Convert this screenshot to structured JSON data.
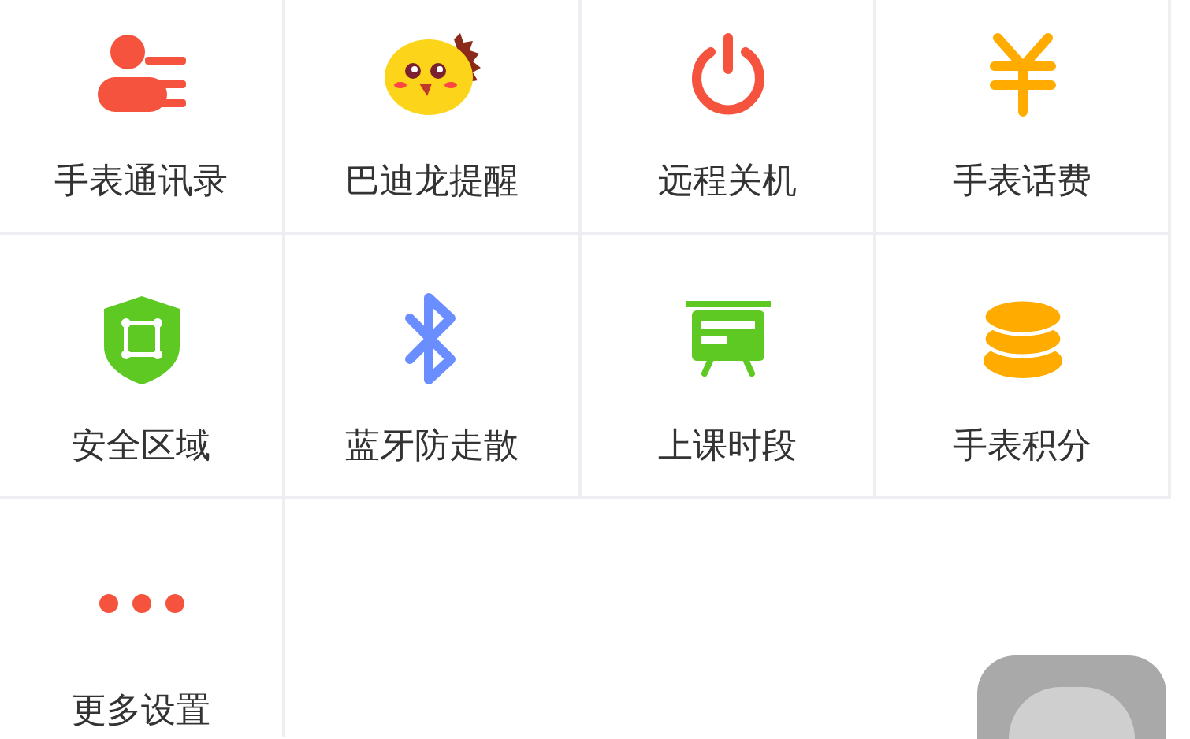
{
  "grid": [
    {
      "label": "手表通讯录",
      "kind": "contacts"
    },
    {
      "label": "巴迪龙提醒",
      "kind": "mascot"
    },
    {
      "label": "远程关机",
      "kind": "power"
    },
    {
      "label": "手表话费",
      "kind": "yen"
    },
    {
      "label": "安全区域",
      "kind": "shield"
    },
    {
      "label": "蓝牙防走散",
      "kind": "bluetooth"
    },
    {
      "label": "上课时段",
      "kind": "board"
    },
    {
      "label": "手表积分",
      "kind": "coins"
    },
    {
      "label": "更多设置",
      "kind": "more"
    }
  ]
}
